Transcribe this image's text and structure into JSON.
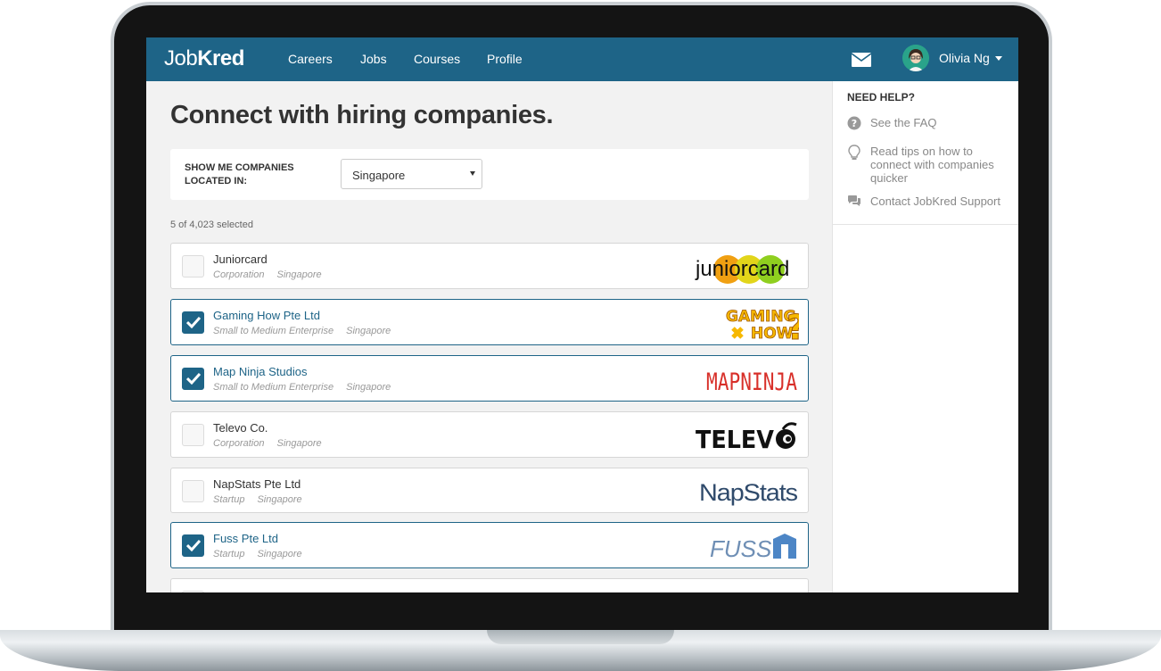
{
  "nav": {
    "brand_light": "Job",
    "brand_bold": "Kred",
    "links": [
      "Careers",
      "Jobs",
      "Courses",
      "Profile"
    ],
    "user_name": "Olivia Ng"
  },
  "main": {
    "title": "Connect with hiring companies.",
    "filter_label": "SHOW ME COMPANIES LOCATED IN:",
    "location": "Singapore",
    "selected_count": "5 of 4,023 selected"
  },
  "companies": [
    {
      "name": "Juniorcard",
      "type": "Corporation",
      "location": "Singapore",
      "checked": false
    },
    {
      "name": "Gaming How Pte Ltd",
      "type": "Small to Medium Enterprise",
      "location": "Singapore",
      "checked": true
    },
    {
      "name": "Map Ninja Studios",
      "type": "Small to Medium Enterprise",
      "location": "Singapore",
      "checked": true
    },
    {
      "name": "Televo Co.",
      "type": "Corporation",
      "location": "Singapore",
      "checked": false
    },
    {
      "name": "NapStats Pte Ltd",
      "type": "Startup",
      "location": "Singapore",
      "checked": false
    },
    {
      "name": "Fuss Pte Ltd",
      "type": "Startup",
      "location": "Singapore",
      "checked": true
    }
  ],
  "logos": {
    "juniorcard": "juniorcard",
    "gaming_1": "GAMING",
    "gaming_2": "HOW",
    "mapninja": "MAPNINJA",
    "televo": "TELEV",
    "napstats": "NapStats",
    "fuss": "FUSS"
  },
  "sidebar": {
    "title": "NEED HELP?",
    "items": [
      "See the FAQ",
      "Read tips on how to connect with companies quicker",
      "Contact JobKred Support"
    ]
  },
  "colors": {
    "primary": "#1e6487",
    "background": "#f2f2f2"
  }
}
